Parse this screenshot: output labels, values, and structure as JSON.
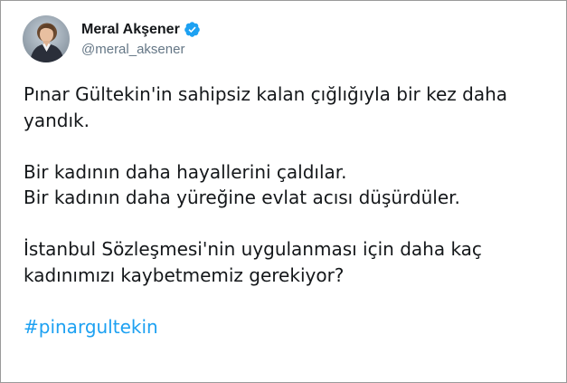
{
  "tweet": {
    "author": {
      "display_name": "Meral Akşener",
      "handle": "@meral_aksener",
      "verified": true,
      "avatar_icon": "profile-photo"
    },
    "paragraphs": [
      {
        "lines": [
          "Pınar Gültekin'in sahipsiz kalan çığlığıyla bir kez daha",
          "yandık."
        ]
      },
      {
        "lines": [
          "Bir kadının daha hayallerini çaldılar.",
          "Bir kadının daha yüreğine evlat acısı düşürdüler."
        ]
      },
      {
        "lines": [
          "İstanbul Sözleşmesi'nin uygulanması için daha kaç",
          "kadınımızı kaybetmemiz gerekiyor?"
        ]
      }
    ],
    "hashtag": "#pinargultekin"
  },
  "colors": {
    "text": "#14171a",
    "handle": "#657786",
    "link": "#1da1f2",
    "verified_badge": "#1da1f2",
    "border": "#9a9a9a"
  }
}
